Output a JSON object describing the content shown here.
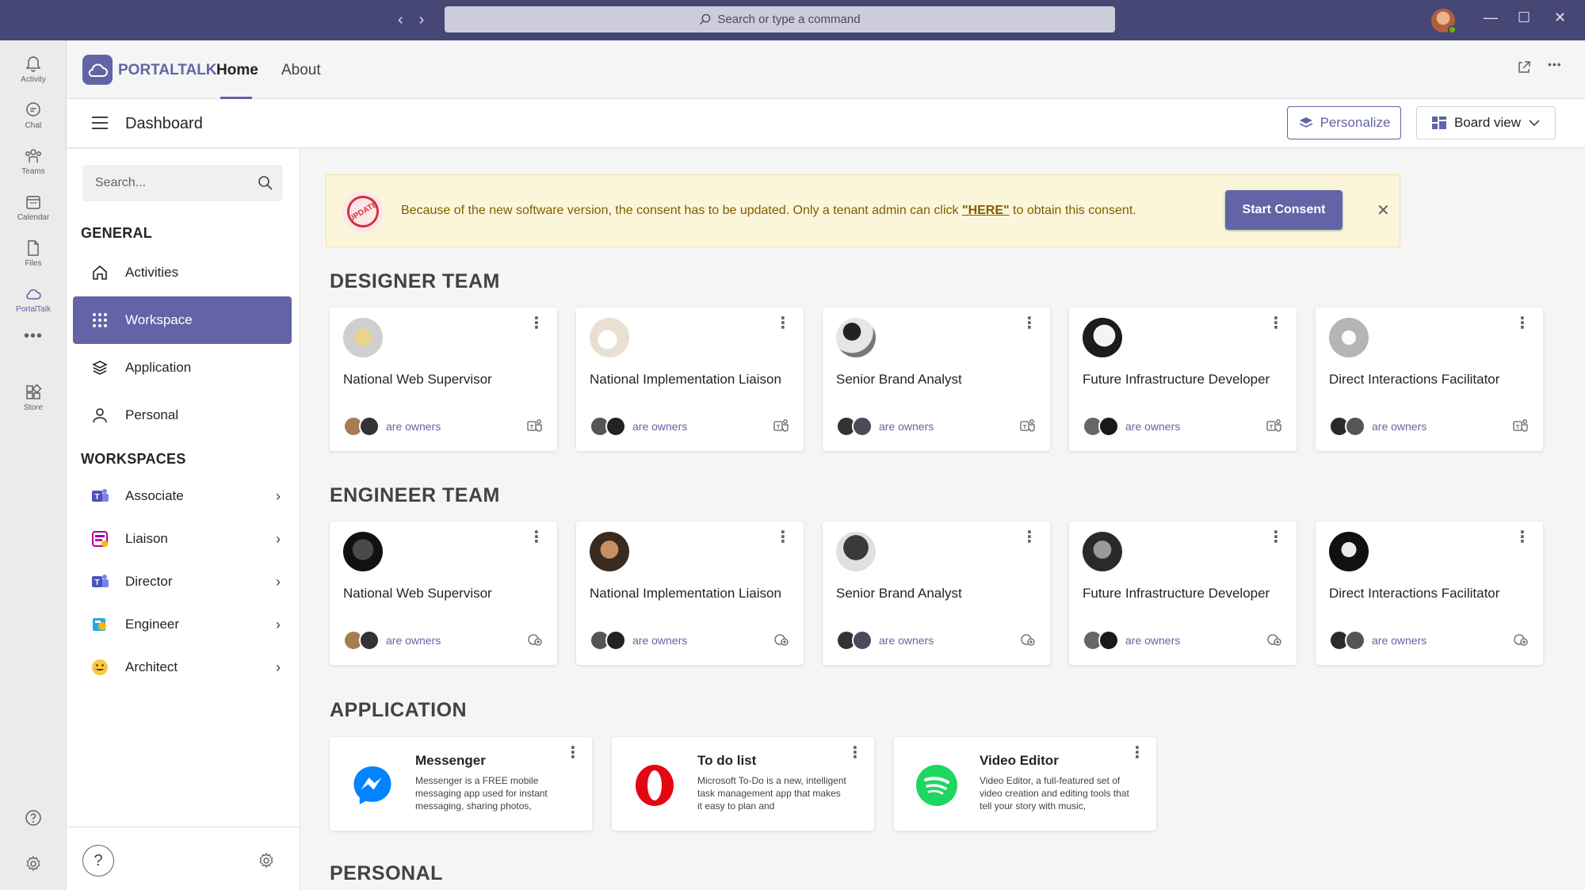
{
  "titlebar": {
    "search_placeholder": "Search or type a command",
    "back_glyph": "‹",
    "forward_glyph": "›",
    "minimize_glyph": "—",
    "maximize_glyph": "☐",
    "close_glyph": "✕"
  },
  "rail": {
    "items": [
      {
        "label": "Activity",
        "icon": "bell-icon"
      },
      {
        "label": "Chat",
        "icon": "chat-icon"
      },
      {
        "label": "Teams",
        "icon": "teams-icon"
      },
      {
        "label": "Calendar",
        "icon": "calendar-icon"
      },
      {
        "label": "Files",
        "icon": "file-icon"
      },
      {
        "label": "PortalTalk",
        "icon": "cloud-icon"
      },
      {
        "label": "Store",
        "icon": "store-icon"
      }
    ],
    "more": "•••"
  },
  "header": {
    "brand": "PORTALTALK",
    "tabs": [
      "Home",
      "About"
    ],
    "active_tab": "Home",
    "more": "•••"
  },
  "dashbar": {
    "title": "Dashboard",
    "personalize": "Personalize",
    "board_view": "Board view"
  },
  "sidebar": {
    "search_placeholder": "Search...",
    "general_title": "GENERAL",
    "general_items": [
      "Activities",
      "Workspace",
      "Application",
      "Personal"
    ],
    "active_item": "Workspace",
    "workspaces_title": "WORKSPACES",
    "workspaces": [
      "Associate",
      "Liaison",
      "Director",
      "Engineer",
      "Architect"
    ],
    "chevron": "›",
    "help": "?"
  },
  "banner": {
    "badge": "UPDATE",
    "text_before": "Because of the new software version, the consent has to be updated. Only a tenant admin can click ",
    "link": "\"HERE\"",
    "text_after": " to obtain this consent.",
    "button": "Start Consent",
    "close": "✕",
    "colors": {
      "background": "#fbf6d9",
      "text": "#835b00",
      "accent": "#6264a7"
    }
  },
  "sections": {
    "designer": {
      "title": "DESIGNER TEAM",
      "cards": [
        {
          "name": "National Web Supervisor",
          "owners": "are owners"
        },
        {
          "name": "National Implementation Liaison",
          "owners": "are owners"
        },
        {
          "name": "Senior Brand Analyst",
          "owners": "are owners"
        },
        {
          "name": "Future Infrastructure Developer",
          "owners": "are owners"
        },
        {
          "name": "Direct Interactions Facilitator",
          "owners": "are owners"
        }
      ]
    },
    "engineer": {
      "title": "ENGINEER TEAM",
      "cards": [
        {
          "name": "National Web Supervisor",
          "owners": "are owners"
        },
        {
          "name": "National Implementation Liaison",
          "owners": "are owners"
        },
        {
          "name": "Senior Brand Analyst",
          "owners": "are owners"
        },
        {
          "name": "Future Infrastructure Developer",
          "owners": "are owners"
        },
        {
          "name": "Direct Interactions Facilitator",
          "owners": "are owners"
        }
      ]
    },
    "application": {
      "title": "APPLICATION",
      "apps": [
        {
          "name": "Messenger",
          "desc": "Messenger is a FREE mobile messaging app used for instant messaging, sharing photos,",
          "icon": "messenger-icon"
        },
        {
          "name": "To do list",
          "desc": "Microsoft To-Do is a new, intelligent task management app that makes it easy to plan and",
          "icon": "opera-icon"
        },
        {
          "name": "Video Editor",
          "desc": "Video Editor, a full-featured set of video creation and editing tools that tell your story with music,",
          "icon": "spotify-icon"
        }
      ]
    },
    "personal": {
      "title": "PERSONAL"
    }
  },
  "colors": {
    "brand": "#6264a7",
    "titlebar": "#464775"
  }
}
